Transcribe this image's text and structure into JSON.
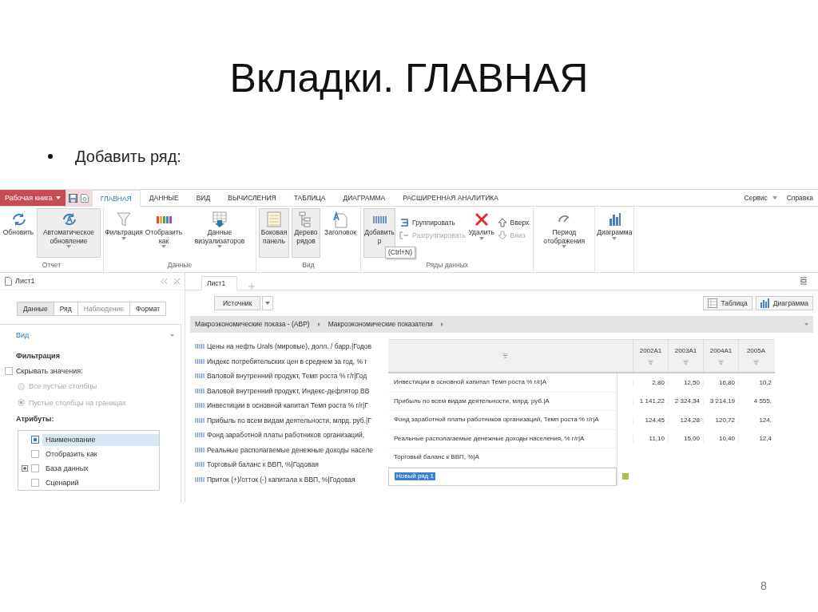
{
  "slide": {
    "title": "Вкладки. ГЛАВНАЯ",
    "bullet": "Добавить ряд:",
    "page_number": "8"
  },
  "app": {
    "workbook_button": "Рабочая книга",
    "tabs": [
      {
        "label": "ГЛАВНАЯ",
        "selected": true
      },
      {
        "label": "ДАННЫЕ",
        "selected": false
      },
      {
        "label": "ВИД",
        "selected": false
      },
      {
        "label": "ВЫЧИСЛЕНИЯ",
        "selected": false
      },
      {
        "label": "ТАБЛИЦА",
        "selected": false
      },
      {
        "label": "ДИАГРАММА",
        "selected": false
      },
      {
        "label": "РАСШИРЕННАЯ АНАЛИТИКА",
        "selected": false
      }
    ],
    "menu": [
      {
        "label": "Сервис",
        "dropdown": true
      },
      {
        "label": "Справка",
        "dropdown": false
      }
    ],
    "ribbon_groups": [
      {
        "label": "Отчет",
        "items": [
          {
            "kind": "large",
            "label": "Обновить",
            "pressed": false,
            "dropdown": false
          },
          {
            "kind": "large",
            "label": "Автоматическое обновление",
            "pressed": true,
            "dropdown": true
          }
        ]
      },
      {
        "label": "Данные",
        "items": [
          {
            "kind": "large",
            "label": "Фильтрация",
            "pressed": false,
            "dropdown": true
          },
          {
            "kind": "large",
            "label": "Отобразить как",
            "pressed": false,
            "dropdown": true
          },
          {
            "kind": "large",
            "label": "Данные визуализаторов",
            "pressed": false,
            "dropdown": true
          }
        ]
      },
      {
        "label": "Вид",
        "items": [
          {
            "kind": "large",
            "label": "Боковая панель",
            "pressed": true,
            "dropdown": false
          },
          {
            "kind": "large",
            "label": "Дерево рядов",
            "pressed": true,
            "dropdown": false
          },
          {
            "kind": "large",
            "label": "Заголовок",
            "pressed": false,
            "dropdown": false
          }
        ]
      },
      {
        "label": "Ряды данных",
        "items": [
          {
            "kind": "large",
            "label": "Добавить р",
            "pressed": true,
            "dropdown": false,
            "tooltip": "(Ctrl+N)"
          },
          {
            "kind": "stack",
            "buttons": [
              {
                "label": "Группировать",
                "disabled": false
              },
              {
                "label": "Разгруппировать",
                "disabled": true
              }
            ]
          },
          {
            "kind": "large",
            "label": "Удалить",
            "pressed": false,
            "dropdown": true
          },
          {
            "kind": "stack",
            "buttons": [
              {
                "label": "Вверх",
                "disabled": false
              },
              {
                "label": "Вниз",
                "disabled": true
              }
            ]
          }
        ]
      },
      {
        "items": [
          {
            "kind": "large",
            "label": "Период отображения",
            "pressed": false,
            "dropdown": true
          }
        ]
      },
      {
        "items": [
          {
            "kind": "large",
            "label": "Диаграмма",
            "pressed": false,
            "dropdown": true
          }
        ]
      }
    ],
    "side_panel": {
      "title": "Лист1",
      "segments": [
        {
          "label": "Данные",
          "selected": true,
          "disabled": false
        },
        {
          "label": "Ряд",
          "selected": false,
          "disabled": false
        },
        {
          "label": "Наблюдение",
          "selected": false,
          "disabled": true
        },
        {
          "label": "Формат",
          "selected": false,
          "disabled": false
        }
      ],
      "section": "Вид",
      "filter_heading": "Фильтрация",
      "hide_values": {
        "label": "Скрывать значения:",
        "checked": false
      },
      "radios": [
        {
          "label": "Все пустые столбцы",
          "selected": false,
          "disabled": true
        },
        {
          "label": "Пустые столбцы на границах",
          "selected": true,
          "disabled": true
        }
      ],
      "attributes_heading": "Атрибуты:",
      "attributes": [
        {
          "label": "Наименование",
          "checked": true,
          "selected": true
        },
        {
          "label": "Отобразить как",
          "checked": false,
          "selected": false
        },
        {
          "label": "База данных",
          "checked": false,
          "selected": false,
          "expanded": false
        },
        {
          "label": "Сценарий",
          "checked": false,
          "selected": false
        }
      ]
    },
    "sheet_tabs": [
      {
        "label": "Лист1",
        "selected": true
      }
    ],
    "source_button": "Источник",
    "view_buttons": [
      {
        "label": "Таблица"
      },
      {
        "label": "Диаграмма"
      }
    ],
    "breadcrumb": [
      "Макроэкономические показа - (АВР)",
      "Макроэкономические показатели"
    ],
    "series": [
      "Цены на нефть Urals (мировые), долл. / барр.|Годов",
      "Индекс  потребительских цен в среднем за год, % г",
      "Валовой внутренний продукт, Темп роста % г/г|Год",
      "Валовой внутренний продукт, Индекс-дефлятор ВВ",
      "Инвестиции в основной капитал Темп роста % г/г|Г",
      "Прибыль по всем видам деятельности, млрд. руб.|Г",
      "Фонд заработной платы работников организаций,",
      "Реальные располагаемые денежные доходы населе",
      "Торговый баланс к ВВП, %|Годовая",
      "Приток (+)/отток (-) капитала к ВВП, %|Годовая"
    ],
    "table": {
      "columns": [
        "2002А1",
        "2003А1",
        "2004А1",
        "2005А"
      ],
      "rows": [
        {
          "kind": "data",
          "name": "Инвестиции в основной капитал Темп роста % г/г|А",
          "values": [
            "2,80",
            "12,50",
            "16,80",
            "10,2"
          ]
        },
        {
          "kind": "data",
          "name": "Прибыль по всем видам деятельности, млрд. руб.|А",
          "values": [
            "1 141,22",
            "2 324,34",
            "3 214,19",
            "4 555,"
          ]
        },
        {
          "kind": "data",
          "name": "Фонд заработной платы работников организаций, Темп роста % г/г|А",
          "values": [
            "124,45",
            "124,28",
            "120,72",
            "124,"
          ]
        },
        {
          "kind": "data",
          "name": "Реальные располагаемые денежные доходы населения, % г/г|А",
          "values": [
            "11,10",
            "15,00",
            "10,40",
            "12,4"
          ]
        },
        {
          "kind": "data",
          "name": "Торговый баланс к ВВП, %|А"
        },
        {
          "kind": "new",
          "name": "Новый ряд 1",
          "selected": true
        }
      ]
    }
  }
}
